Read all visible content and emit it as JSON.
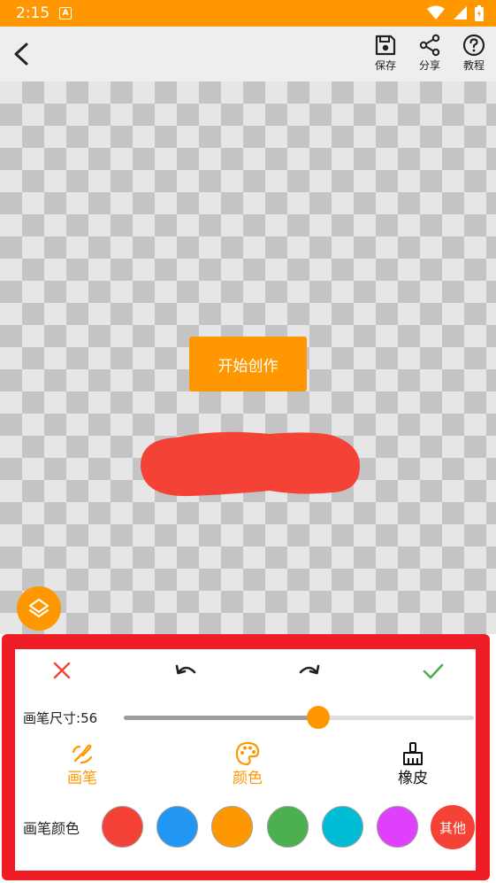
{
  "status_bar": {
    "time": "2:15",
    "notification_letter": "A",
    "background": "#FF9800"
  },
  "toolbar": {
    "save_label": "保存",
    "share_label": "分享",
    "tutorial_label": "教程"
  },
  "canvas": {
    "start_button_label": "开始创作",
    "stroke_color": "#F44336"
  },
  "panel": {
    "size_label_prefix": "画笔尺寸:",
    "size_value": "56",
    "slider_fraction": 0.555,
    "modes": [
      {
        "label": "画笔",
        "icon": "brush-icon",
        "color": "#FF9800",
        "selected": true
      },
      {
        "label": "颜色",
        "icon": "palette-icon",
        "color": "#FF9800",
        "selected": false
      },
      {
        "label": "橡皮",
        "icon": "eraser-broom-icon",
        "color": "#111111",
        "selected": false
      }
    ],
    "color_label": "画笔颜色",
    "swatches": [
      "#F44336",
      "#2196F3",
      "#FF9800",
      "#4CAF50",
      "#00BCD4",
      "#E040FB"
    ],
    "other_label": "其他",
    "close_color": "#F44336",
    "confirm_color": "#4CAF50"
  }
}
